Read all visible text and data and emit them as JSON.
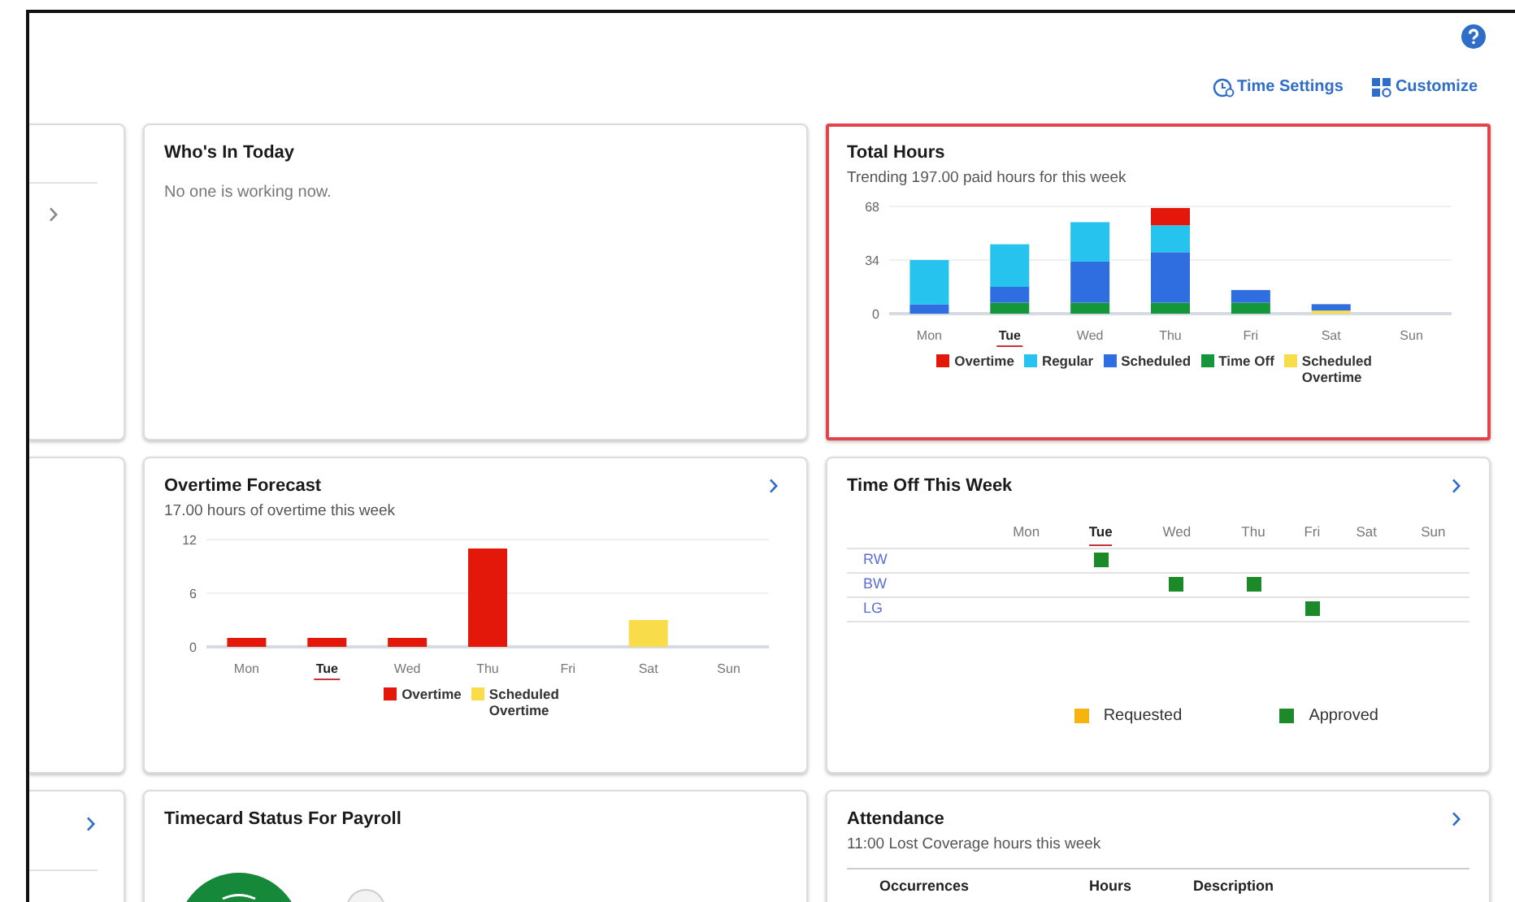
{
  "header": {
    "links": [
      {
        "kind": "time-settings",
        "label": "Time Settings"
      },
      {
        "kind": "customize",
        "label": "Customize"
      }
    ]
  },
  "left_cards": [
    {
      "chevron": true
    },
    {
      "chevron": false
    },
    {
      "chevron": true
    }
  ],
  "cards": [
    {
      "kind": "whos_in",
      "title": "Who's In Today",
      "message": "No one is working now.",
      "chevron": false,
      "highlighted": false
    },
    {
      "kind": "chart",
      "title": "Total Hours",
      "subtitle": "Trending 197.00 paid hours for this week",
      "chevron": false,
      "highlighted": true,
      "day_marks": [
        {
          "selected": false
        },
        {
          "selected": true
        },
        {
          "selected": false
        },
        {
          "selected": false
        },
        {
          "selected": false
        },
        {
          "selected": false
        },
        {
          "selected": false
        }
      ],
      "chart_data": {
        "type": "bar",
        "stacked": true,
        "legend": "bottom",
        "categories": [
          "Mon",
          "Tue",
          "Wed",
          "Thu",
          "Fri",
          "Sat",
          "Sun"
        ],
        "ylim": [
          0,
          68
        ],
        "yticks": [
          0,
          34,
          68
        ],
        "series": [
          {
            "name": "Overtime",
            "color": "#e3170a",
            "values": [
              0,
              0,
              0,
              11,
              0,
              0,
              0
            ]
          },
          {
            "name": "Regular",
            "color": "#27c3ef",
            "values": [
              28,
              27,
              25,
              17,
              0,
              0,
              0
            ]
          },
          {
            "name": "Scheduled",
            "color": "#2f6ee0",
            "values": [
              6,
              10,
              26,
              32,
              8,
              4,
              0
            ]
          },
          {
            "name": "Time Off",
            "color": "#14963a",
            "values": [
              0,
              7,
              7,
              7,
              7,
              0,
              0
            ]
          },
          {
            "name": "Scheduled Overtime",
            "color": "#f9dc4a",
            "values": [
              0,
              0,
              0,
              0,
              0,
              2,
              0
            ]
          }
        ]
      }
    },
    {
      "kind": "chart",
      "title": "Overtime Forecast",
      "subtitle": "17.00 hours of overtime this week",
      "chevron": true,
      "highlighted": false,
      "day_marks": [
        {
          "selected": false
        },
        {
          "selected": true
        },
        {
          "selected": false
        },
        {
          "selected": false
        },
        {
          "selected": false
        },
        {
          "selected": false
        },
        {
          "selected": false
        }
      ],
      "chart_data": {
        "type": "bar",
        "stacked": true,
        "legend": "bottom",
        "categories": [
          "Mon",
          "Tue",
          "Wed",
          "Thu",
          "Fri",
          "Sat",
          "Sun"
        ],
        "ylim": [
          0,
          12
        ],
        "yticks": [
          0,
          6,
          12
        ],
        "series": [
          {
            "name": "Overtime",
            "color": "#e3170a",
            "values": [
              1,
              1,
              1,
              11,
              0,
              0,
              0
            ]
          },
          {
            "name": "Scheduled Overtime",
            "color": "#f9dc4a",
            "values": [
              0,
              0,
              0,
              0,
              0,
              3,
              0
            ]
          }
        ]
      }
    },
    {
      "kind": "time_off",
      "title": "Time Off This Week",
      "chevron": true,
      "highlighted": false,
      "days": [
        {
          "label": "Mon",
          "selected": false
        },
        {
          "label": "Tue",
          "selected": true
        },
        {
          "label": "Wed",
          "selected": false
        },
        {
          "label": "Thu",
          "selected": false
        },
        {
          "label": "Fri",
          "selected": false
        },
        {
          "label": "Sat",
          "selected": false
        },
        {
          "label": "Sun",
          "selected": false
        }
      ],
      "rows": [
        {
          "name": "RW",
          "cells": [
            null,
            {
              "color": "#1d8a2a"
            },
            null,
            null,
            null,
            null,
            null
          ]
        },
        {
          "name": "BW",
          "cells": [
            null,
            null,
            {
              "color": "#1d8a2a"
            },
            {
              "color": "#1d8a2a"
            },
            null,
            null,
            null
          ]
        },
        {
          "name": "LG",
          "cells": [
            null,
            null,
            null,
            null,
            {
              "color": "#1d8a2a"
            },
            null,
            null
          ]
        }
      ],
      "legend": [
        {
          "label": "Requested",
          "color": "#f6b40e"
        },
        {
          "label": "Approved",
          "color": "#1d8a2a"
        }
      ]
    },
    {
      "kind": "timecard",
      "title": "Timecard Status For Payroll",
      "chevron": false,
      "highlighted": false
    },
    {
      "kind": "attendance",
      "title": "Attendance",
      "subtitle": "11:00 Lost Coverage hours this week",
      "chevron": true,
      "highlighted": false,
      "columns": [
        "Occurrences",
        "Hours",
        "Description"
      ]
    }
  ]
}
